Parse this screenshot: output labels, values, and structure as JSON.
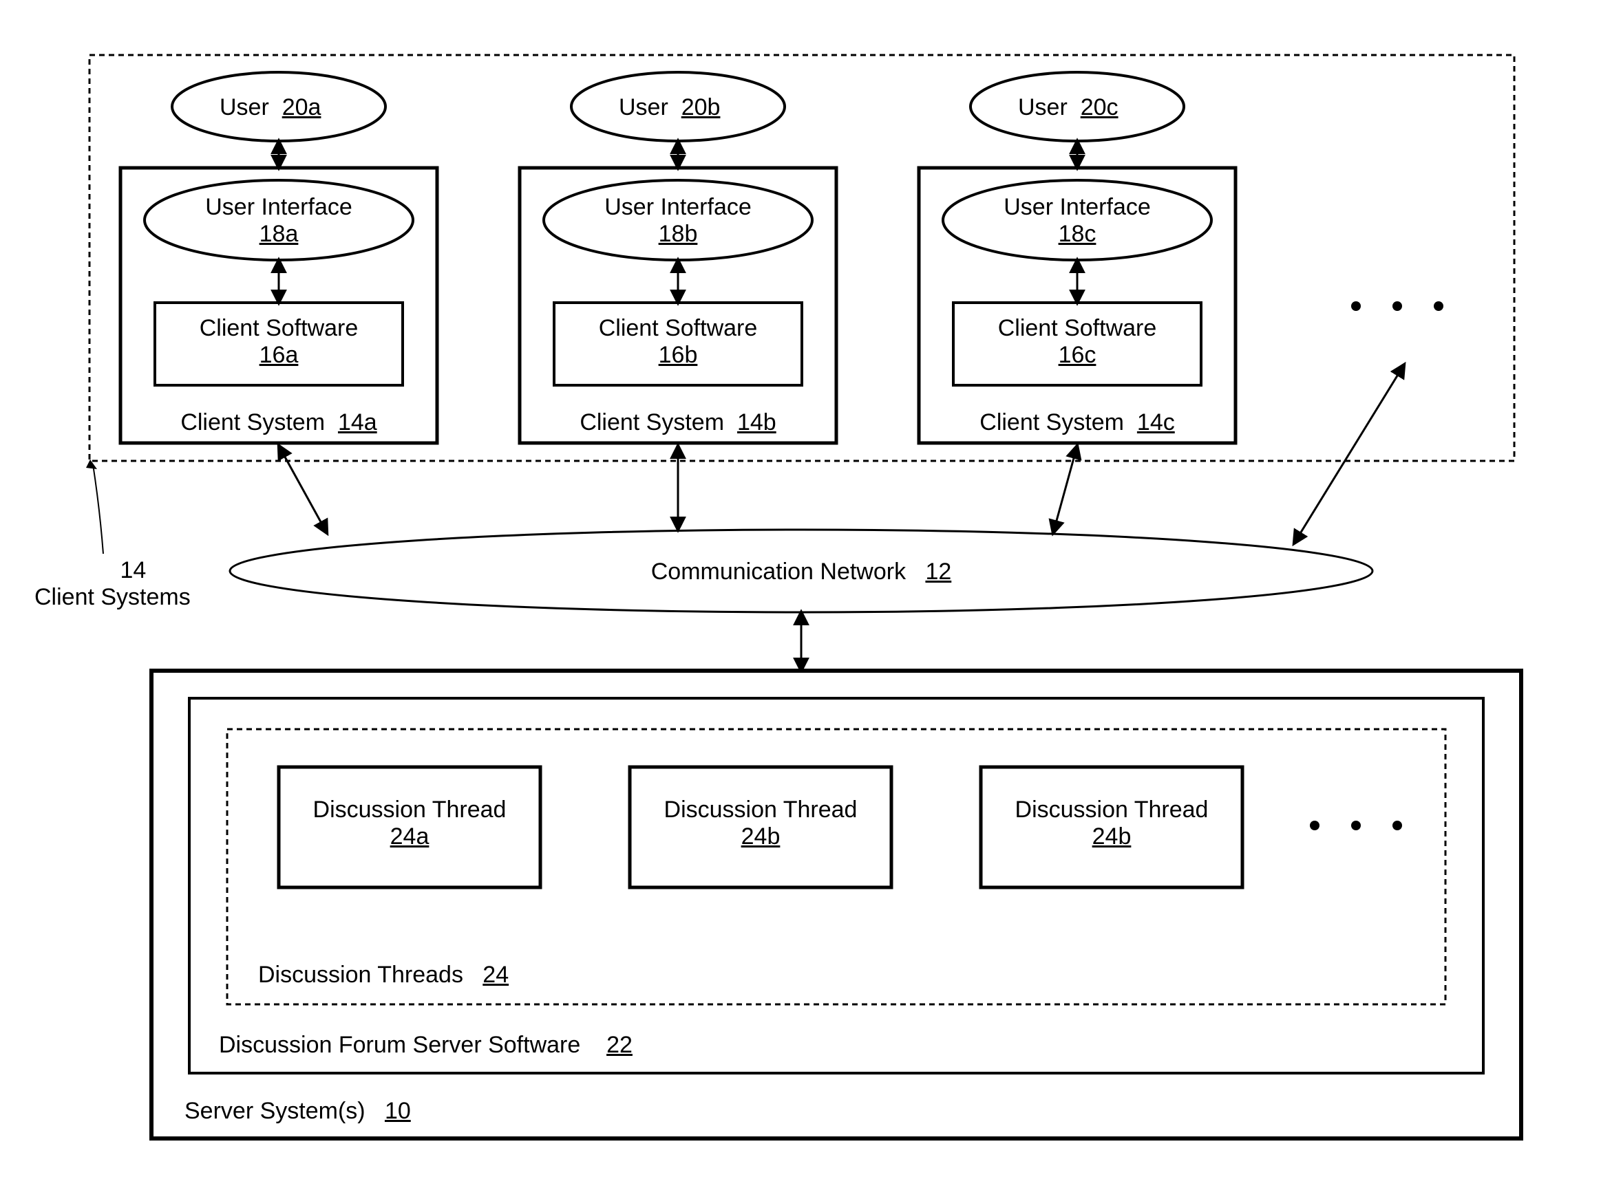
{
  "users": [
    {
      "label": "User",
      "ref": "20a"
    },
    {
      "label": "User",
      "ref": "20b"
    },
    {
      "label": "User",
      "ref": "20c"
    }
  ],
  "userInterfaces": [
    {
      "label": "User Interface",
      "ref": "18a"
    },
    {
      "label": "User Interface",
      "ref": "18b"
    },
    {
      "label": "User Interface",
      "ref": "18c"
    }
  ],
  "clientSoftware": [
    {
      "label": "Client Software",
      "ref": "16a"
    },
    {
      "label": "Client Software",
      "ref": "16b"
    },
    {
      "label": "Client Software",
      "ref": "16c"
    }
  ],
  "clientSystems": [
    {
      "label": "Client System",
      "ref": "14a"
    },
    {
      "label": "Client System",
      "ref": "14b"
    },
    {
      "label": "Client System",
      "ref": "14c"
    }
  ],
  "clientSystemsGroup": {
    "ref": "14",
    "label": "Client Systems"
  },
  "network": {
    "label": "Communication Network",
    "ref": "12"
  },
  "threads": [
    {
      "label": "Discussion Thread",
      "ref": "24a"
    },
    {
      "label": "Discussion Thread",
      "ref": "24b"
    },
    {
      "label": "Discussion Thread",
      "ref": "24b"
    }
  ],
  "threadsGroup": {
    "label": "Discussion Threads",
    "ref": "24"
  },
  "serverSoftware": {
    "label": "Discussion Forum Server Software",
    "ref": "22"
  },
  "serverSystems": {
    "label": "Server System(s)",
    "ref": "10"
  },
  "ellipsis": ". . ."
}
